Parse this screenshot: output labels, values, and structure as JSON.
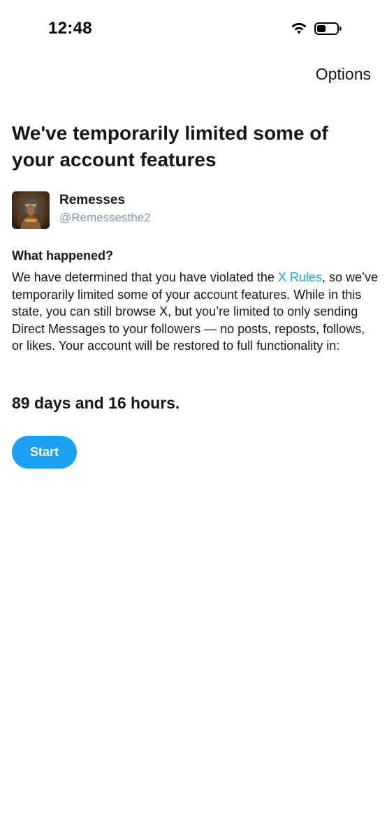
{
  "status_bar": {
    "time": "12:48",
    "wifi_icon": "wifi-icon",
    "battery_icon": "battery-low-icon"
  },
  "header": {
    "options_label": "Options"
  },
  "title": "We've temporarily limited some of your account features",
  "profile": {
    "name": "Remesses",
    "handle": "@Remessesthe2",
    "avatar_icon": "avatar"
  },
  "explanation": {
    "heading": "What happened?",
    "text_before_link": "We have determined that you have violated the ",
    "link_label": "X Rules",
    "text_after_link": ", so we’ve temporarily limited some of your account features. While in this state, you can still browse X, but you’re limited to only sending Direct Messages to your followers — no posts, reposts, follows, or likes. Your account will be restored to full functionality in:"
  },
  "countdown": "89 days and 16 hours.",
  "actions": {
    "start_label": "Start"
  },
  "colors": {
    "accent": "#1da1f2",
    "text": "#14171a",
    "secondary_text": "#8899a6"
  }
}
